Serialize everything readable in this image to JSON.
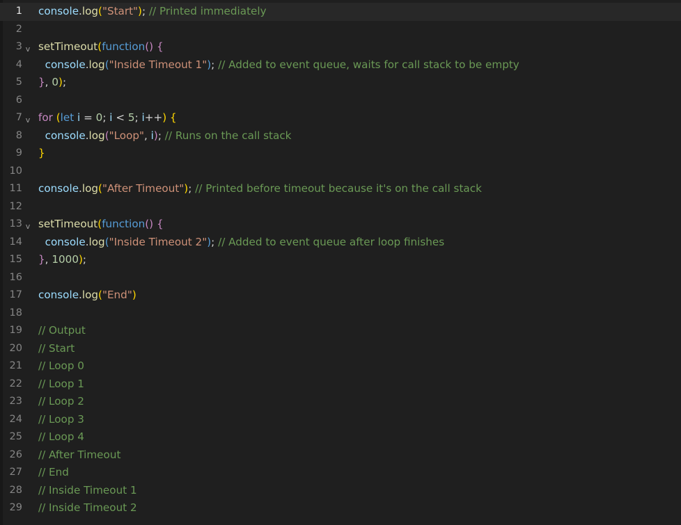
{
  "editor": {
    "current_line": 1,
    "lines": [
      {
        "number": "1",
        "fold": "",
        "tokens": [
          {
            "t": "console",
            "c": "obj"
          },
          {
            "t": ".",
            "c": "punc"
          },
          {
            "t": "log",
            "c": "fn"
          },
          {
            "t": "(",
            "c": "brace"
          },
          {
            "t": "\"Start\"",
            "c": "str"
          },
          {
            "t": ")",
            "c": "brace"
          },
          {
            "t": "; ",
            "c": "punc"
          },
          {
            "t": "// Printed immediately",
            "c": "cmt"
          }
        ]
      },
      {
        "number": "2",
        "fold": "",
        "tokens": []
      },
      {
        "number": "3",
        "fold": "v",
        "tokens": [
          {
            "t": "setTimeout",
            "c": "fn"
          },
          {
            "t": "(",
            "c": "brace"
          },
          {
            "t": "function",
            "c": "kw"
          },
          {
            "t": "()",
            "c": "ctl"
          },
          {
            "t": " ",
            "c": "punc"
          },
          {
            "t": "{",
            "c": "ctl"
          }
        ]
      },
      {
        "number": "4",
        "fold": "",
        "tokens": [
          {
            "t": "  ",
            "c": "punc"
          },
          {
            "t": "console",
            "c": "obj"
          },
          {
            "t": ".",
            "c": "punc"
          },
          {
            "t": "log",
            "c": "fn"
          },
          {
            "t": "(",
            "c": "kw"
          },
          {
            "t": "\"Inside Timeout 1\"",
            "c": "str"
          },
          {
            "t": ")",
            "c": "kw"
          },
          {
            "t": "; ",
            "c": "punc"
          },
          {
            "t": "// Added to event queue, waits for call stack to be empty",
            "c": "cmt"
          }
        ]
      },
      {
        "number": "5",
        "fold": "",
        "tokens": [
          {
            "t": "}",
            "c": "ctl"
          },
          {
            "t": ", ",
            "c": "punc"
          },
          {
            "t": "0",
            "c": "num"
          },
          {
            "t": ")",
            "c": "brace"
          },
          {
            "t": ";",
            "c": "punc"
          }
        ]
      },
      {
        "number": "6",
        "fold": "",
        "tokens": []
      },
      {
        "number": "7",
        "fold": "v",
        "tokens": [
          {
            "t": "for",
            "c": "ctl"
          },
          {
            "t": " ",
            "c": "punc"
          },
          {
            "t": "(",
            "c": "brace"
          },
          {
            "t": "let",
            "c": "kw"
          },
          {
            "t": " ",
            "c": "punc"
          },
          {
            "t": "i",
            "c": "var"
          },
          {
            "t": " = ",
            "c": "op"
          },
          {
            "t": "0",
            "c": "num"
          },
          {
            "t": "; ",
            "c": "punc"
          },
          {
            "t": "i",
            "c": "var"
          },
          {
            "t": " < ",
            "c": "op"
          },
          {
            "t": "5",
            "c": "num"
          },
          {
            "t": "; ",
            "c": "punc"
          },
          {
            "t": "i",
            "c": "var"
          },
          {
            "t": "++",
            "c": "op"
          },
          {
            "t": ")",
            "c": "brace"
          },
          {
            "t": " ",
            "c": "punc"
          },
          {
            "t": "{",
            "c": "brace"
          }
        ]
      },
      {
        "number": "8",
        "fold": "",
        "tokens": [
          {
            "t": "  ",
            "c": "punc"
          },
          {
            "t": "console",
            "c": "obj"
          },
          {
            "t": ".",
            "c": "punc"
          },
          {
            "t": "log",
            "c": "fn"
          },
          {
            "t": "(",
            "c": "ctl"
          },
          {
            "t": "\"Loop\"",
            "c": "str"
          },
          {
            "t": ", ",
            "c": "punc"
          },
          {
            "t": "i",
            "c": "var"
          },
          {
            "t": ")",
            "c": "ctl"
          },
          {
            "t": "; ",
            "c": "punc"
          },
          {
            "t": "// Runs on the call stack",
            "c": "cmt"
          }
        ]
      },
      {
        "number": "9",
        "fold": "",
        "tokens": [
          {
            "t": "}",
            "c": "brace"
          }
        ]
      },
      {
        "number": "10",
        "fold": "",
        "tokens": []
      },
      {
        "number": "11",
        "fold": "",
        "tokens": [
          {
            "t": "console",
            "c": "obj"
          },
          {
            "t": ".",
            "c": "punc"
          },
          {
            "t": "log",
            "c": "fn"
          },
          {
            "t": "(",
            "c": "brace"
          },
          {
            "t": "\"After Timeout\"",
            "c": "str"
          },
          {
            "t": ")",
            "c": "brace"
          },
          {
            "t": "; ",
            "c": "punc"
          },
          {
            "t": "// Printed before timeout because it's on the call stack",
            "c": "cmt"
          }
        ]
      },
      {
        "number": "12",
        "fold": "",
        "tokens": []
      },
      {
        "number": "13",
        "fold": "v",
        "tokens": [
          {
            "t": "setTimeout",
            "c": "fn"
          },
          {
            "t": "(",
            "c": "brace"
          },
          {
            "t": "function",
            "c": "kw"
          },
          {
            "t": "()",
            "c": "ctl"
          },
          {
            "t": " ",
            "c": "punc"
          },
          {
            "t": "{",
            "c": "ctl"
          }
        ]
      },
      {
        "number": "14",
        "fold": "",
        "tokens": [
          {
            "t": "  ",
            "c": "punc"
          },
          {
            "t": "console",
            "c": "obj"
          },
          {
            "t": ".",
            "c": "punc"
          },
          {
            "t": "log",
            "c": "fn"
          },
          {
            "t": "(",
            "c": "kw"
          },
          {
            "t": "\"Inside Timeout 2\"",
            "c": "str"
          },
          {
            "t": ")",
            "c": "kw"
          },
          {
            "t": "; ",
            "c": "punc"
          },
          {
            "t": "// Added to event queue after loop finishes",
            "c": "cmt"
          }
        ]
      },
      {
        "number": "15",
        "fold": "",
        "tokens": [
          {
            "t": "}",
            "c": "ctl"
          },
          {
            "t": ", ",
            "c": "punc"
          },
          {
            "t": "1000",
            "c": "num"
          },
          {
            "t": ")",
            "c": "brace"
          },
          {
            "t": ";",
            "c": "punc"
          }
        ]
      },
      {
        "number": "16",
        "fold": "",
        "tokens": []
      },
      {
        "number": "17",
        "fold": "",
        "tokens": [
          {
            "t": "console",
            "c": "obj"
          },
          {
            "t": ".",
            "c": "punc"
          },
          {
            "t": "log",
            "c": "fn"
          },
          {
            "t": "(",
            "c": "brace"
          },
          {
            "t": "\"End\"",
            "c": "str"
          },
          {
            "t": ")",
            "c": "brace"
          }
        ]
      },
      {
        "number": "18",
        "fold": "",
        "tokens": []
      },
      {
        "number": "19",
        "fold": "",
        "tokens": [
          {
            "t": "// Output",
            "c": "cmt"
          }
        ]
      },
      {
        "number": "20",
        "fold": "",
        "tokens": [
          {
            "t": "// Start",
            "c": "cmt"
          }
        ]
      },
      {
        "number": "21",
        "fold": "",
        "tokens": [
          {
            "t": "// Loop 0",
            "c": "cmt"
          }
        ]
      },
      {
        "number": "22",
        "fold": "",
        "tokens": [
          {
            "t": "// Loop 1",
            "c": "cmt"
          }
        ]
      },
      {
        "number": "23",
        "fold": "",
        "tokens": [
          {
            "t": "// Loop 2",
            "c": "cmt"
          }
        ]
      },
      {
        "number": "24",
        "fold": "",
        "tokens": [
          {
            "t": "// Loop 3",
            "c": "cmt"
          }
        ]
      },
      {
        "number": "25",
        "fold": "",
        "tokens": [
          {
            "t": "// Loop 4",
            "c": "cmt"
          }
        ]
      },
      {
        "number": "26",
        "fold": "",
        "tokens": [
          {
            "t": "// After Timeout",
            "c": "cmt"
          }
        ]
      },
      {
        "number": "27",
        "fold": "",
        "tokens": [
          {
            "t": "// End",
            "c": "cmt"
          }
        ]
      },
      {
        "number": "28",
        "fold": "",
        "tokens": [
          {
            "t": "// Inside Timeout 1",
            "c": "cmt"
          }
        ]
      },
      {
        "number": "29",
        "fold": "",
        "tokens": [
          {
            "t": "// Inside Timeout 2",
            "c": "cmt"
          }
        ]
      }
    ]
  },
  "icons": {
    "fold": "chevron-down-icon"
  },
  "colors": {
    "background": "#1f1f1f",
    "current_line": "#282828",
    "line_number": "#858585",
    "line_number_active": "#e6e6e6",
    "comment": "#6a9955",
    "string": "#ce9178",
    "function": "#dcdcaa",
    "object": "#9cdcfe",
    "keyword": "#569cd6",
    "control": "#c586c0",
    "number": "#b5cea8",
    "bracket": "#ffd700"
  }
}
